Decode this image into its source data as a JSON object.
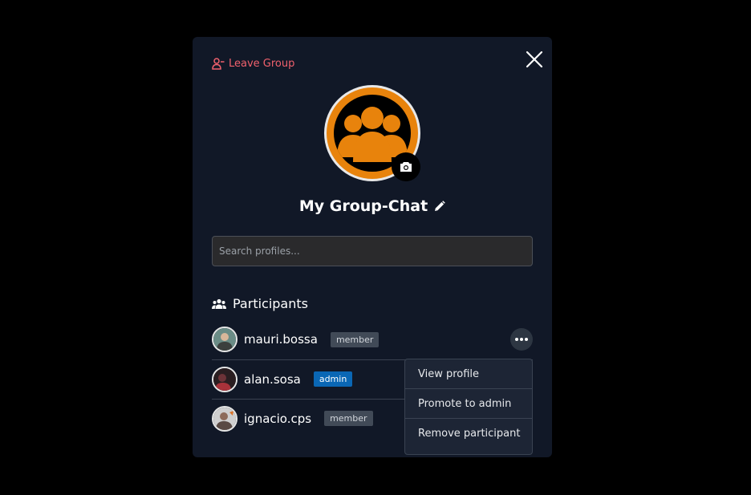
{
  "modal": {
    "leave_label": "Leave Group",
    "group_name": "My Group-Chat",
    "search": {
      "placeholder": "Search profiles...",
      "value": ""
    },
    "participants_heading": "Participants",
    "participants": [
      {
        "username": "mauri.bossa",
        "role": "member"
      },
      {
        "username": "alan.sosa",
        "role": "admin"
      },
      {
        "username": "ignacio.cps",
        "role": "member"
      }
    ],
    "context_menu": {
      "items": [
        "View profile",
        "Promote to admin",
        "Remove participant"
      ]
    }
  },
  "colors": {
    "overlay": "#000000",
    "panel": "#111827",
    "accent_orange": "#e8830c",
    "danger": "#f0616d",
    "admin_badge": "#0a67b5",
    "member_badge": "#414a57"
  },
  "icons": [
    "leave-group-icon",
    "close-icon",
    "group-avatar-icon",
    "camera-icon",
    "pencil-icon",
    "users-icon",
    "more-horizontal-icon"
  ]
}
